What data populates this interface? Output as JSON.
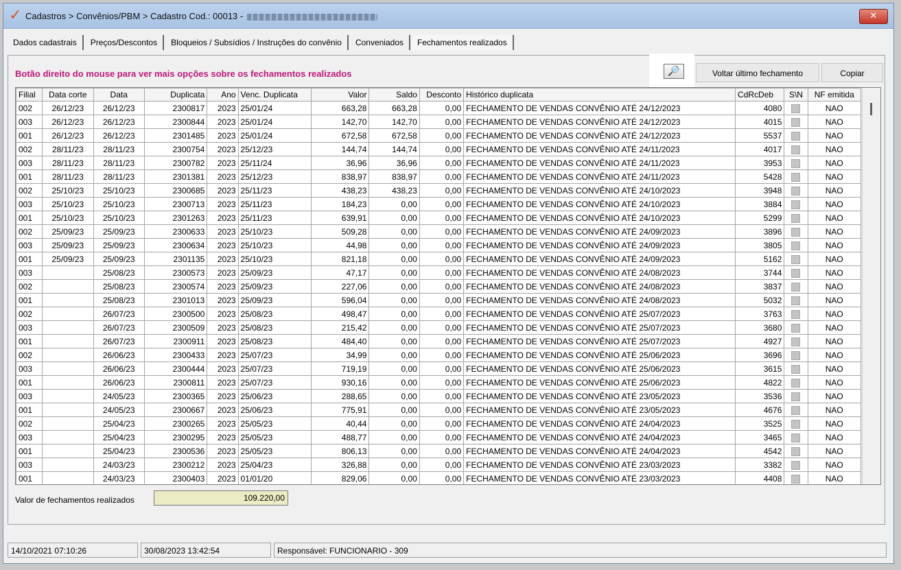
{
  "window": {
    "title": "Cadastros > Convênios/PBM > Cadastro  Cod.: 00013 -",
    "close_glyph": "✕"
  },
  "tabs": [
    {
      "label": "Dados cadastrais"
    },
    {
      "label": "Preços/Descontos"
    },
    {
      "label": "Bloqueios / Subsídios / Instruções do convênio"
    },
    {
      "label": "Conveniados"
    },
    {
      "label": "Fechamentos realizados"
    }
  ],
  "panel": {
    "hint": "Botão direito do mouse para ver mais opções sobre os fechamentos realizados",
    "search_glyph": "🔎",
    "voltar_label": "Voltar último fechamento",
    "copiar_label": "Copiar"
  },
  "grid": {
    "columns": [
      "Filial",
      "Data corte",
      "Data",
      "Duplicata",
      "Ano",
      "Venc. Duplicata",
      "Valor",
      "Saldo",
      "Desconto",
      "Histórico duplicata",
      "CdRcDeb",
      "S\\N",
      "NF emitida"
    ],
    "rows": [
      [
        "002",
        "26/12/23",
        "26/12/23",
        "2300817",
        "2023",
        "25/01/24",
        "663,28",
        "663,28",
        "0,00",
        "FECHAMENTO DE VENDAS CONVÊNIO ATÉ 24/12/2023",
        "4080",
        "NAO"
      ],
      [
        "003",
        "26/12/23",
        "26/12/23",
        "2300844",
        "2023",
        "25/01/24",
        "142,70",
        "142,70",
        "0,00",
        "FECHAMENTO DE VENDAS CONVÊNIO ATÉ 24/12/2023",
        "4015",
        "NAO"
      ],
      [
        "001",
        "26/12/23",
        "26/12/23",
        "2301485",
        "2023",
        "25/01/24",
        "672,58",
        "672,58",
        "0,00",
        "FECHAMENTO DE VENDAS CONVÊNIO ATÉ 24/12/2023",
        "5537",
        "NAO"
      ],
      [
        "002",
        "28/11/23",
        "28/11/23",
        "2300754",
        "2023",
        "25/12/23",
        "144,74",
        "144,74",
        "0,00",
        "FECHAMENTO DE VENDAS CONVÊNIO ATÉ 24/11/2023",
        "4017",
        "NAO"
      ],
      [
        "003",
        "28/11/23",
        "28/11/23",
        "2300782",
        "2023",
        "25/11/24",
        "36,96",
        "36,96",
        "0,00",
        "FECHAMENTO DE VENDAS CONVÊNIO ATÉ 24/11/2023",
        "3953",
        "NAO"
      ],
      [
        "001",
        "28/11/23",
        "28/11/23",
        "2301381",
        "2023",
        "25/12/23",
        "838,97",
        "838,97",
        "0,00",
        "FECHAMENTO DE VENDAS CONVÊNIO ATÉ 24/11/2023",
        "5428",
        "NAO"
      ],
      [
        "002",
        "25/10/23",
        "25/10/23",
        "2300685",
        "2023",
        "25/11/23",
        "438,23",
        "438,23",
        "0,00",
        "FECHAMENTO DE VENDAS CONVÊNIO ATÉ 24/10/2023",
        "3948",
        "NAO"
      ],
      [
        "003",
        "25/10/23",
        "25/10/23",
        "2300713",
        "2023",
        "25/11/23",
        "184,23",
        "0,00",
        "0,00",
        "FECHAMENTO DE VENDAS CONVÊNIO ATÉ 24/10/2023",
        "3884",
        "NAO"
      ],
      [
        "001",
        "25/10/23",
        "25/10/23",
        "2301263",
        "2023",
        "25/11/23",
        "639,91",
        "0,00",
        "0,00",
        "FECHAMENTO DE VENDAS CONVÊNIO ATÉ 24/10/2023",
        "5299",
        "NAO"
      ],
      [
        "002",
        "25/09/23",
        "25/09/23",
        "2300633",
        "2023",
        "25/10/23",
        "509,28",
        "0,00",
        "0,00",
        "FECHAMENTO DE VENDAS CONVÊNIO ATÉ 24/09/2023",
        "3896",
        "NAO"
      ],
      [
        "003",
        "25/09/23",
        "25/09/23",
        "2300634",
        "2023",
        "25/10/23",
        "44,98",
        "0,00",
        "0,00",
        "FECHAMENTO DE VENDAS CONVÊNIO ATÉ 24/09/2023",
        "3805",
        "NAO"
      ],
      [
        "001",
        "25/09/23",
        "25/09/23",
        "2301135",
        "2023",
        "25/10/23",
        "821,18",
        "0,00",
        "0,00",
        "FECHAMENTO DE VENDAS CONVÊNIO ATÉ 24/09/2023",
        "5162",
        "NAO"
      ],
      [
        "003",
        "",
        "25/08/23",
        "2300573",
        "2023",
        "25/09/23",
        "47,17",
        "0,00",
        "0,00",
        "FECHAMENTO DE VENDAS CONVÊNIO ATÉ 24/08/2023",
        "3744",
        "NAO"
      ],
      [
        "002",
        "",
        "25/08/23",
        "2300574",
        "2023",
        "25/09/23",
        "227,06",
        "0,00",
        "0,00",
        "FECHAMENTO DE VENDAS CONVÊNIO ATÉ 24/08/2023",
        "3837",
        "NAO"
      ],
      [
        "001",
        "",
        "25/08/23",
        "2301013",
        "2023",
        "25/09/23",
        "596,04",
        "0,00",
        "0,00",
        "FECHAMENTO DE VENDAS CONVÊNIO ATÉ 24/08/2023",
        "5032",
        "NAO"
      ],
      [
        "002",
        "",
        "26/07/23",
        "2300500",
        "2023",
        "25/08/23",
        "498,47",
        "0,00",
        "0,00",
        "FECHAMENTO DE VENDAS CONVÊNIO ATÉ 25/07/2023",
        "3763",
        "NAO"
      ],
      [
        "003",
        "",
        "26/07/23",
        "2300509",
        "2023",
        "25/08/23",
        "215,42",
        "0,00",
        "0,00",
        "FECHAMENTO DE VENDAS CONVÊNIO ATÉ 25/07/2023",
        "3680",
        "NAO"
      ],
      [
        "001",
        "",
        "26/07/23",
        "2300911",
        "2023",
        "25/08/23",
        "484,40",
        "0,00",
        "0,00",
        "FECHAMENTO DE VENDAS CONVÊNIO ATÉ 25/07/2023",
        "4927",
        "NAO"
      ],
      [
        "002",
        "",
        "26/06/23",
        "2300433",
        "2023",
        "25/07/23",
        "34,99",
        "0,00",
        "0,00",
        "FECHAMENTO DE VENDAS CONVÊNIO ATÉ 25/06/2023",
        "3696",
        "NAO"
      ],
      [
        "003",
        "",
        "26/06/23",
        "2300444",
        "2023",
        "25/07/23",
        "719,19",
        "0,00",
        "0,00",
        "FECHAMENTO DE VENDAS CONVÊNIO ATÉ 25/06/2023",
        "3615",
        "NAO"
      ],
      [
        "001",
        "",
        "26/06/23",
        "2300811",
        "2023",
        "25/07/23",
        "930,16",
        "0,00",
        "0,00",
        "FECHAMENTO DE VENDAS CONVÊNIO ATÉ 25/06/2023",
        "4822",
        "NAO"
      ],
      [
        "003",
        "",
        "24/05/23",
        "2300365",
        "2023",
        "25/06/23",
        "288,65",
        "0,00",
        "0,00",
        "FECHAMENTO DE VENDAS CONVÊNIO ATÉ 23/05/2023",
        "3536",
        "NAO"
      ],
      [
        "001",
        "",
        "24/05/23",
        "2300667",
        "2023",
        "25/06/23",
        "775,91",
        "0,00",
        "0,00",
        "FECHAMENTO DE VENDAS CONVÊNIO ATÉ 23/05/2023",
        "4676",
        "NAO"
      ],
      [
        "002",
        "",
        "25/04/23",
        "2300265",
        "2023",
        "25/05/23",
        "40,44",
        "0,00",
        "0,00",
        "FECHAMENTO DE VENDAS CONVÊNIO ATÉ 24/04/2023",
        "3525",
        "NAO"
      ],
      [
        "003",
        "",
        "25/04/23",
        "2300295",
        "2023",
        "25/05/23",
        "488,77",
        "0,00",
        "0,00",
        "FECHAMENTO DE VENDAS CONVÊNIO ATÉ 24/04/2023",
        "3465",
        "NAO"
      ],
      [
        "001",
        "",
        "25/04/23",
        "2300536",
        "2023",
        "25/05/23",
        "806,13",
        "0,00",
        "0,00",
        "FECHAMENTO DE VENDAS CONVÊNIO ATÉ 24/04/2023",
        "4542",
        "NAO"
      ],
      [
        "003",
        "",
        "24/03/23",
        "2300212",
        "2023",
        "25/04/23",
        "326,88",
        "0,00",
        "0,00",
        "FECHAMENTO DE VENDAS CONVÊNIO ATÉ 23/03/2023",
        "3382",
        "NAO"
      ],
      [
        "001",
        "",
        "24/03/23",
        "2300403",
        "2023",
        "01/01/20",
        "829,06",
        "0,00",
        "0,00",
        "FECHAMENTO DE VENDAS CONVÊNIO ATÉ 23/03/2023",
        "4408",
        "NAO"
      ]
    ]
  },
  "totals": {
    "label": "Valor de fechamentos realizados",
    "value": "109.220,00"
  },
  "status": {
    "created": "14/10/2021 07:10:26",
    "updated": "30/08/2023 13:42:54",
    "responsible": "Responsável: FUNCIONARIO - 309"
  },
  "icons": {
    "app": "app-logo-icon",
    "search": "magnifier-icon",
    "close": "close-icon"
  },
  "colors": {
    "hint": "#c0167a",
    "total_field": "#ececc4",
    "titlebar": "#bcd3ee"
  }
}
